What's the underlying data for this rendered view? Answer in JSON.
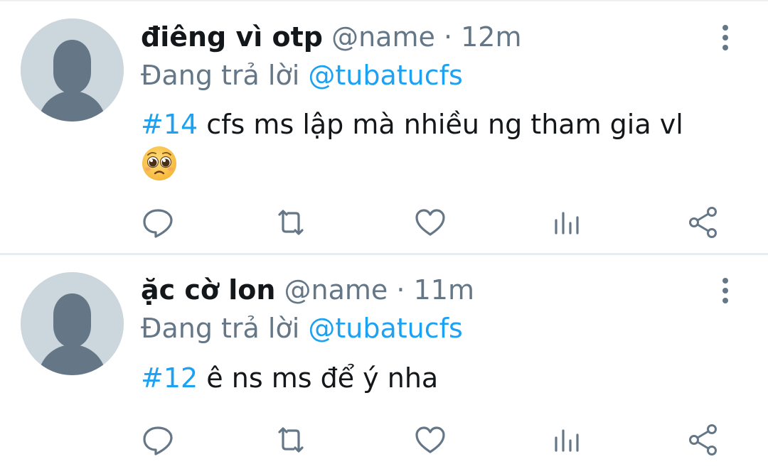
{
  "colors": {
    "accent": "#1da1f2",
    "text_primary": "#14171a",
    "text_secondary": "#657786",
    "avatar_bg": "#ccd6dd",
    "avatar_fg": "#657786",
    "divider": "#e6ecf0"
  },
  "tweets": [
    {
      "display_name": "điêng vì otp",
      "handle": "@name",
      "separator": "·",
      "time": "12m",
      "reply_prefix": "Đang trả lời",
      "reply_to": "@tubatucfs",
      "hashtag": "#14",
      "text": " cfs ms lập mà nhiều ng tham gia vl",
      "emoji": "pleading-face",
      "icons": [
        "reply-icon",
        "retweet-icon",
        "like-icon",
        "stats-icon",
        "share-icon",
        "more-icon"
      ]
    },
    {
      "display_name": "ặc cờ lon",
      "handle": "@name",
      "separator": "·",
      "time": "11m",
      "reply_prefix": "Đang trả lời",
      "reply_to": "@tubatucfs",
      "hashtag": "#12",
      "text": " ê ns ms để ý nha",
      "icons": [
        "reply-icon",
        "retweet-icon",
        "like-icon",
        "stats-icon",
        "share-icon",
        "more-icon"
      ]
    }
  ]
}
